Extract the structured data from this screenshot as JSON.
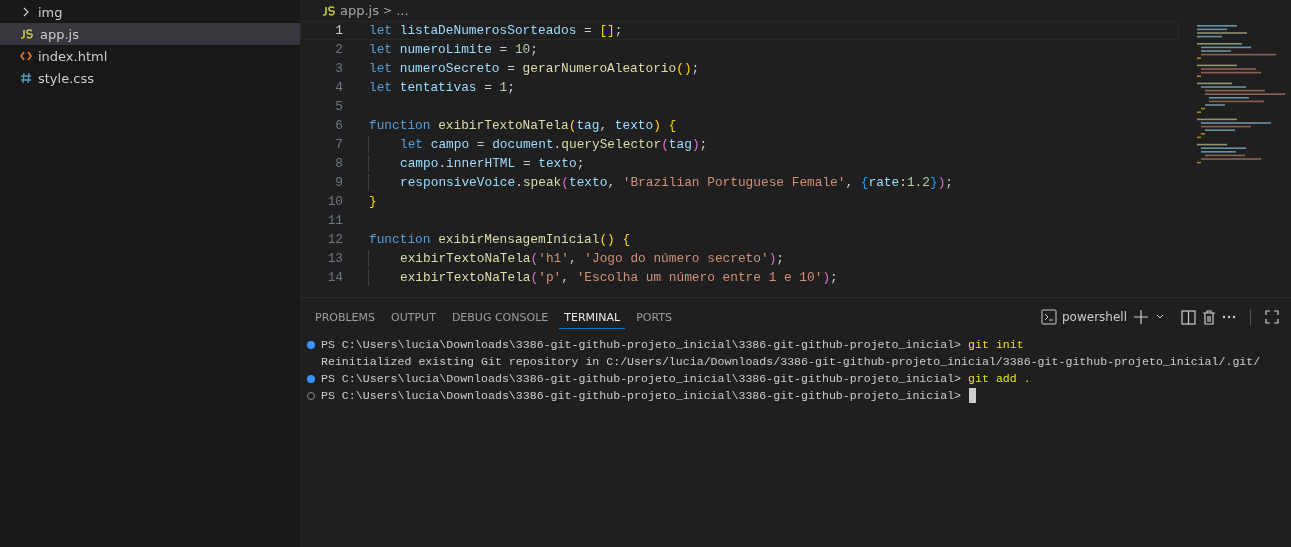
{
  "explorer": {
    "items": [
      {
        "kind": "folder",
        "label": "img",
        "expanded": false,
        "selected": false
      },
      {
        "kind": "js",
        "label": "app.js",
        "selected": true
      },
      {
        "kind": "html",
        "label": "index.html",
        "selected": false
      },
      {
        "kind": "css",
        "label": "style.css",
        "selected": false
      }
    ]
  },
  "breadcrumb": {
    "file": "app.js",
    "separator": ">",
    "rest": "..."
  },
  "editor": {
    "lines": [
      {
        "number": "1",
        "current": true,
        "indented": false,
        "tokens": [
          {
            "text": "let ",
            "kind": "keyword"
          },
          {
            "text": "listaDeNumerosSorteados",
            "kind": "variable"
          },
          {
            "text": " = ",
            "kind": "plain"
          },
          {
            "text": "[]",
            "kind": "bracket1"
          },
          {
            "text": ";",
            "kind": "plain"
          }
        ]
      },
      {
        "number": "2",
        "current": false,
        "indented": false,
        "tokens": [
          {
            "text": "let ",
            "kind": "keyword"
          },
          {
            "text": "numeroLimite",
            "kind": "variable"
          },
          {
            "text": " = ",
            "kind": "plain"
          },
          {
            "text": "10",
            "kind": "number"
          },
          {
            "text": ";",
            "kind": "plain"
          }
        ]
      },
      {
        "number": "3",
        "current": false,
        "indented": false,
        "tokens": [
          {
            "text": "let ",
            "kind": "keyword"
          },
          {
            "text": "numeroSecreto",
            "kind": "variable"
          },
          {
            "text": " = ",
            "kind": "plain"
          },
          {
            "text": "gerarNumeroAleatorio",
            "kind": "function"
          },
          {
            "text": "()",
            "kind": "bracket1"
          },
          {
            "text": ";",
            "kind": "plain"
          }
        ]
      },
      {
        "number": "4",
        "current": false,
        "indented": false,
        "tokens": [
          {
            "text": "let ",
            "kind": "keyword"
          },
          {
            "text": "tentativas",
            "kind": "variable"
          },
          {
            "text": " = ",
            "kind": "plain"
          },
          {
            "text": "1",
            "kind": "number"
          },
          {
            "text": ";",
            "kind": "plain"
          }
        ]
      },
      {
        "number": "5",
        "current": false,
        "indented": false
      },
      {
        "number": "6",
        "current": false,
        "indented": false,
        "tokens": [
          {
            "text": "function ",
            "kind": "keyword"
          },
          {
            "text": "exibirTextoNaTela",
            "kind": "function"
          },
          {
            "text": "(",
            "kind": "bracket1"
          },
          {
            "text": "tag",
            "kind": "variable"
          },
          {
            "text": ", ",
            "kind": "plain"
          },
          {
            "text": "texto",
            "kind": "variable"
          },
          {
            "text": ")",
            "kind": "bracket1"
          },
          {
            "text": " {",
            "kind": "bracket1"
          }
        ]
      },
      {
        "number": "7",
        "current": false,
        "indented": true,
        "tokens": [
          {
            "text": "let ",
            "kind": "keyword"
          },
          {
            "text": "campo",
            "kind": "variable"
          },
          {
            "text": " = ",
            "kind": "plain"
          },
          {
            "text": "document",
            "kind": "variable"
          },
          {
            "text": ".",
            "kind": "plain"
          },
          {
            "text": "querySelector",
            "kind": "function"
          },
          {
            "text": "(",
            "kind": "bracket2"
          },
          {
            "text": "tag",
            "kind": "variable"
          },
          {
            "text": ")",
            "kind": "bracket2"
          },
          {
            "text": ";",
            "kind": "plain"
          }
        ]
      },
      {
        "number": "8",
        "current": false,
        "indented": true,
        "tokens": [
          {
            "text": "campo",
            "kind": "variable"
          },
          {
            "text": ".",
            "kind": "plain"
          },
          {
            "text": "innerHTML",
            "kind": "variable"
          },
          {
            "text": " = ",
            "kind": "plain"
          },
          {
            "text": "texto",
            "kind": "variable"
          },
          {
            "text": ";",
            "kind": "plain"
          }
        ]
      },
      {
        "number": "9",
        "current": false,
        "indented": true,
        "tokens": [
          {
            "text": "responsiveVoice",
            "kind": "variable"
          },
          {
            "text": ".",
            "kind": "plain"
          },
          {
            "text": "speak",
            "kind": "function"
          },
          {
            "text": "(",
            "kind": "bracket2"
          },
          {
            "text": "texto",
            "kind": "variable"
          },
          {
            "text": ", ",
            "kind": "plain"
          },
          {
            "text": "'Brazilian Portuguese Female'",
            "kind": "string"
          },
          {
            "text": ", ",
            "kind": "plain"
          },
          {
            "text": "{",
            "kind": "bracket3"
          },
          {
            "text": "rate",
            "kind": "variable"
          },
          {
            "text": ":",
            "kind": "plain"
          },
          {
            "text": "1.2",
            "kind": "number"
          },
          {
            "text": "}",
            "kind": "bracket3"
          },
          {
            "text": ")",
            "kind": "bracket2"
          },
          {
            "text": ";",
            "kind": "plain"
          }
        ]
      },
      {
        "number": "10",
        "current": false,
        "indented": false,
        "tokens": [
          {
            "text": "}",
            "kind": "bracket1"
          }
        ]
      },
      {
        "number": "11",
        "current": false,
        "indented": false
      },
      {
        "number": "12",
        "current": false,
        "indented": false,
        "tokens": [
          {
            "text": "function ",
            "kind": "keyword"
          },
          {
            "text": "exibirMensagemInicial",
            "kind": "function"
          },
          {
            "text": "()",
            "kind": "bracket1"
          },
          {
            "text": " {",
            "kind": "bracket1"
          }
        ]
      },
      {
        "number": "13",
        "current": false,
        "indented": true,
        "tokens": [
          {
            "text": "exibirTextoNaTela",
            "kind": "function"
          },
          {
            "text": "(",
            "kind": "bracket2"
          },
          {
            "text": "'h1'",
            "kind": "string"
          },
          {
            "text": ", ",
            "kind": "plain"
          },
          {
            "text": "'Jogo do número secreto'",
            "kind": "string"
          },
          {
            "text": ")",
            "kind": "bracket2"
          },
          {
            "text": ";",
            "kind": "plain"
          }
        ]
      },
      {
        "number": "14",
        "current": false,
        "indented": true,
        "tokens": [
          {
            "text": "exibirTextoNaTela",
            "kind": "function"
          },
          {
            "text": "(",
            "kind": "bracket2"
          },
          {
            "text": "'p'",
            "kind": "string"
          },
          {
            "text": ", ",
            "kind": "plain"
          },
          {
            "text": "'Escolha um número entre 1 e 10'",
            "kind": "string"
          },
          {
            "text": ")",
            "kind": "bracket2"
          },
          {
            "text": ";",
            "kind": "plain"
          }
        ]
      }
    ]
  },
  "panel": {
    "tabs": [
      {
        "label": "PROBLEMS",
        "selected": false
      },
      {
        "label": "OUTPUT",
        "selected": false
      },
      {
        "label": "DEBUG CONSOLE",
        "selected": false
      },
      {
        "label": "TERMINAL",
        "selected": true
      },
      {
        "label": "PORTS",
        "selected": false
      }
    ],
    "terminal_name": "powershell"
  },
  "terminal": {
    "lines": [
      {
        "kind": "command",
        "finished": true,
        "prompt": "PS C:\\Users\\lucia\\Downloads\\3386-git-github-projeto_inicial\\3386-git-github-projeto_inicial>",
        "command": "git init",
        "cursor": false
      },
      {
        "kind": "output",
        "text": "Reinitialized existing Git repository in C:/Users/lucia/Downloads/3386-git-github-projeto_inicial/3386-git-github-projeto_inicial/.git/"
      },
      {
        "kind": "command",
        "finished": true,
        "prompt": "PS C:\\Users\\lucia\\Downloads\\3386-git-github-projeto_inicial\\3386-git-github-projeto_inicial>",
        "command": "git add .",
        "cursor": false
      },
      {
        "kind": "command",
        "finished": false,
        "prompt": "PS C:\\Users\\lucia\\Downloads\\3386-git-github-projeto_inicial\\3386-git-github-projeto_inicial>",
        "cursor": true
      }
    ]
  }
}
